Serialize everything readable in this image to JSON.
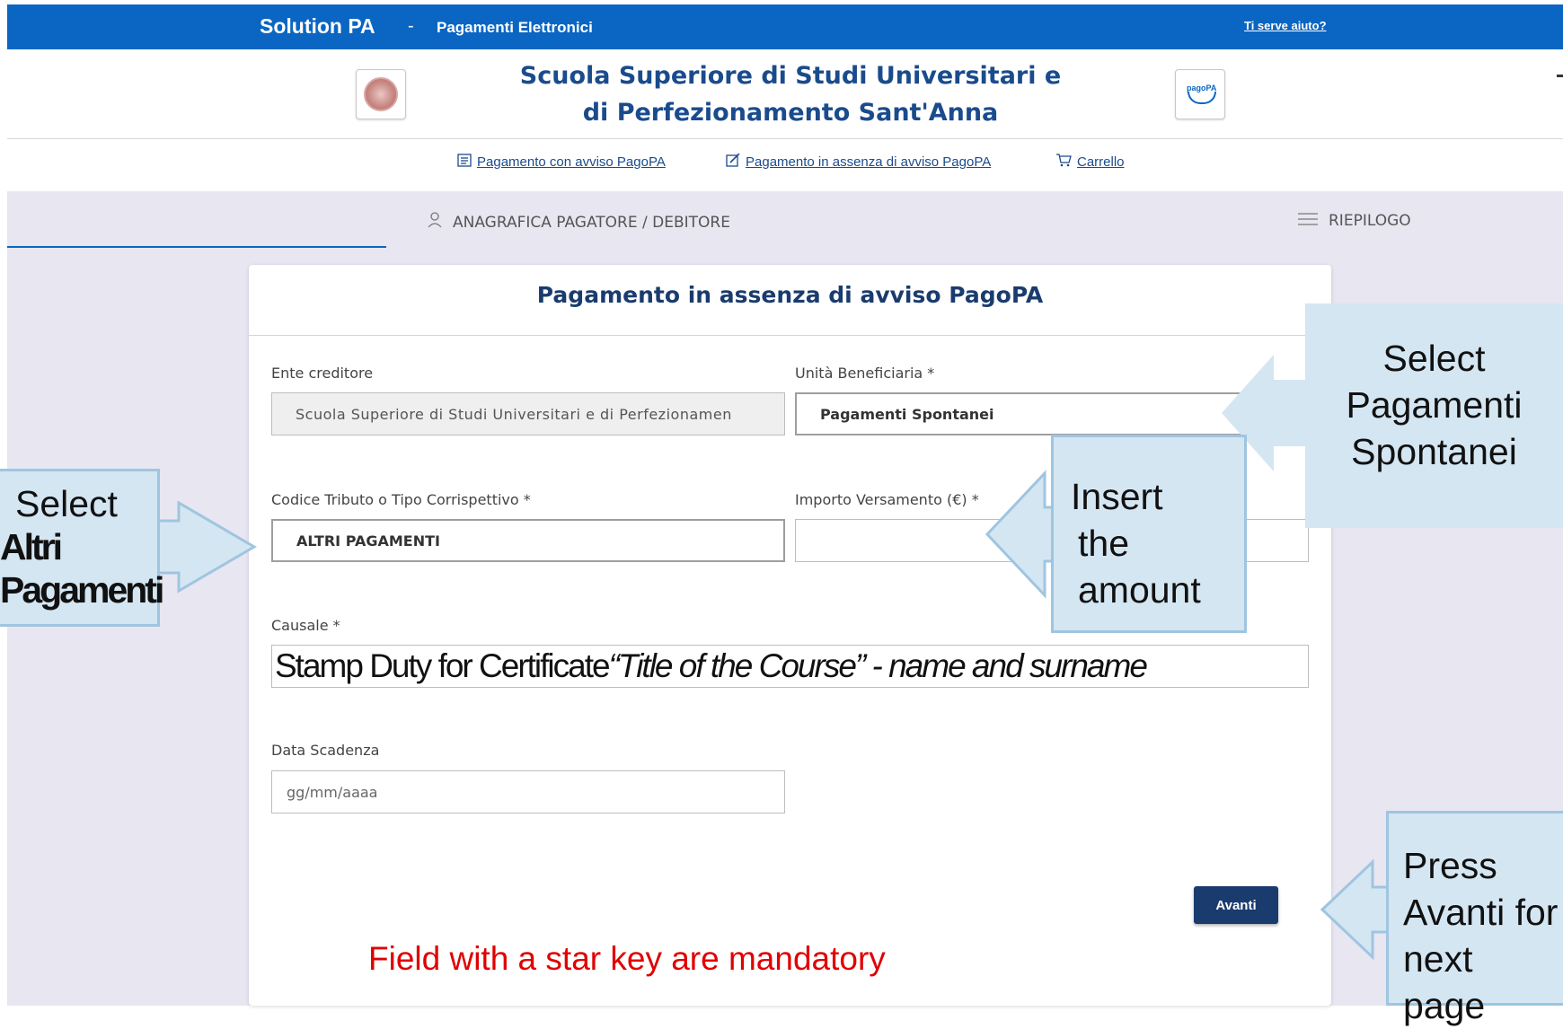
{
  "topbar": {
    "brand": "Solution PA",
    "separator": "-",
    "subtitle": "Pagamenti Elettronici",
    "help_link": "Ti serve aiuto?"
  },
  "header": {
    "institution_line1": "Scuola Superiore di Studi Universitari e",
    "institution_line2": "di Perfezionamento Sant'Anna",
    "right_logo_text": "pagoPA"
  },
  "nav": {
    "items": [
      {
        "label": "Pagamento con avviso PagoPA",
        "icon": "document-list-icon"
      },
      {
        "label": "Pagamento in assenza di avviso PagoPA",
        "icon": "edit-icon"
      },
      {
        "label": "Carrello",
        "icon": "cart-icon"
      }
    ]
  },
  "steps": {
    "items": [
      {
        "label": "ANAGRAFICA PAGATORE / DEBITORE",
        "icon": "user-icon"
      },
      {
        "label": "RIEPILOGO",
        "icon": "list-icon"
      }
    ]
  },
  "form": {
    "title": "Pagamento in assenza di avviso PagoPA",
    "ente": {
      "label": "Ente creditore",
      "value": "Scuola Superiore di Studi Universitari e di Perfezionamen"
    },
    "unita": {
      "label": "Unità Beneficiaria *",
      "value": "Pagamenti Spontanei"
    },
    "codice": {
      "label": "Codice Tributo o Tipo Corrispettivo *",
      "value": "ALTRI PAGAMENTI"
    },
    "importo": {
      "label": "Importo Versamento (€) *",
      "value": ""
    },
    "causale": {
      "label": "Causale *",
      "value_prefix": "Stamp Duty for Certificate ",
      "value_italic": "“Title of the Course” - name and surname"
    },
    "scadenza": {
      "label": "Data Scadenza",
      "placeholder": "gg/mm/aaaa"
    },
    "submit_label": "Avanti"
  },
  "annotations": {
    "note": "Field with a star key are mandatory",
    "callout_unita": [
      "Select",
      "Pagamenti",
      "Spontanei"
    ],
    "callout_codice": {
      "line1": "Select",
      "line2": "Altri",
      "line3": "Pagamenti"
    },
    "callout_importo": [
      "Insert",
      "the",
      "amount"
    ],
    "callout_avanti": [
      "Press",
      "Avanti for",
      "next page"
    ]
  },
  "colors": {
    "topbar": "#0a66c2",
    "institution_text": "#1a4b8c",
    "band": "#e8e6f1",
    "button": "#1a3b6e",
    "callout_fill": "#d4e6f2",
    "callout_border": "#9fc5e0",
    "note": "#e00000"
  }
}
